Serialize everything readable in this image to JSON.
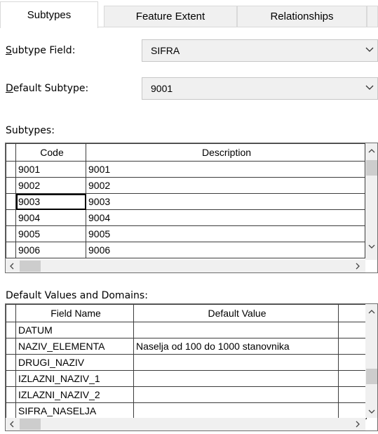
{
  "tabs": [
    {
      "label": "Subtypes"
    },
    {
      "label": "Feature Extent"
    },
    {
      "label": "Relationships"
    }
  ],
  "subtype_field": {
    "label_u": "S",
    "label_rest": "ubtype Field:",
    "value": "SIFRA"
  },
  "default_subtype": {
    "label_u": "D",
    "label_rest": "efault Subtype:",
    "value": "9001"
  },
  "subtypes_section": {
    "label": "Subtypes:"
  },
  "subtypes_table": {
    "columns": [
      "Code",
      "Description"
    ],
    "rows": [
      {
        "code": "9001",
        "desc": "9001"
      },
      {
        "code": "9002",
        "desc": "9002"
      },
      {
        "code": "9003",
        "desc": "9003"
      },
      {
        "code": "9004",
        "desc": "9004"
      },
      {
        "code": "9005",
        "desc": "9005"
      },
      {
        "code": "9006",
        "desc": "9006"
      }
    ]
  },
  "defaults_section": {
    "label": "Default Values and Domains:"
  },
  "defaults_table": {
    "columns": [
      "Field Name",
      "Default Value",
      ""
    ],
    "rows": [
      {
        "field": "DATUM",
        "value": ""
      },
      {
        "field": "NAZIV_ELEMENTA",
        "value": "Naselja od 100 do 1000 stanovnika"
      },
      {
        "field": "DRUGI_NAZIV",
        "value": ""
      },
      {
        "field": "IZLAZNI_NAZIV_1",
        "value": ""
      },
      {
        "field": "IZLAZNI_NAZIV_2",
        "value": ""
      },
      {
        "field": "SIFRA_NASELJA",
        "value": ""
      }
    ]
  },
  "icons": {
    "dropdown": "chevron-down-icon",
    "scroll_up": "scroll-up-arrow-icon",
    "scroll_down": "scroll-down-arrow-icon",
    "scroll_left": "scroll-left-arrow-icon",
    "scroll_right": "scroll-right-arrow-icon"
  }
}
